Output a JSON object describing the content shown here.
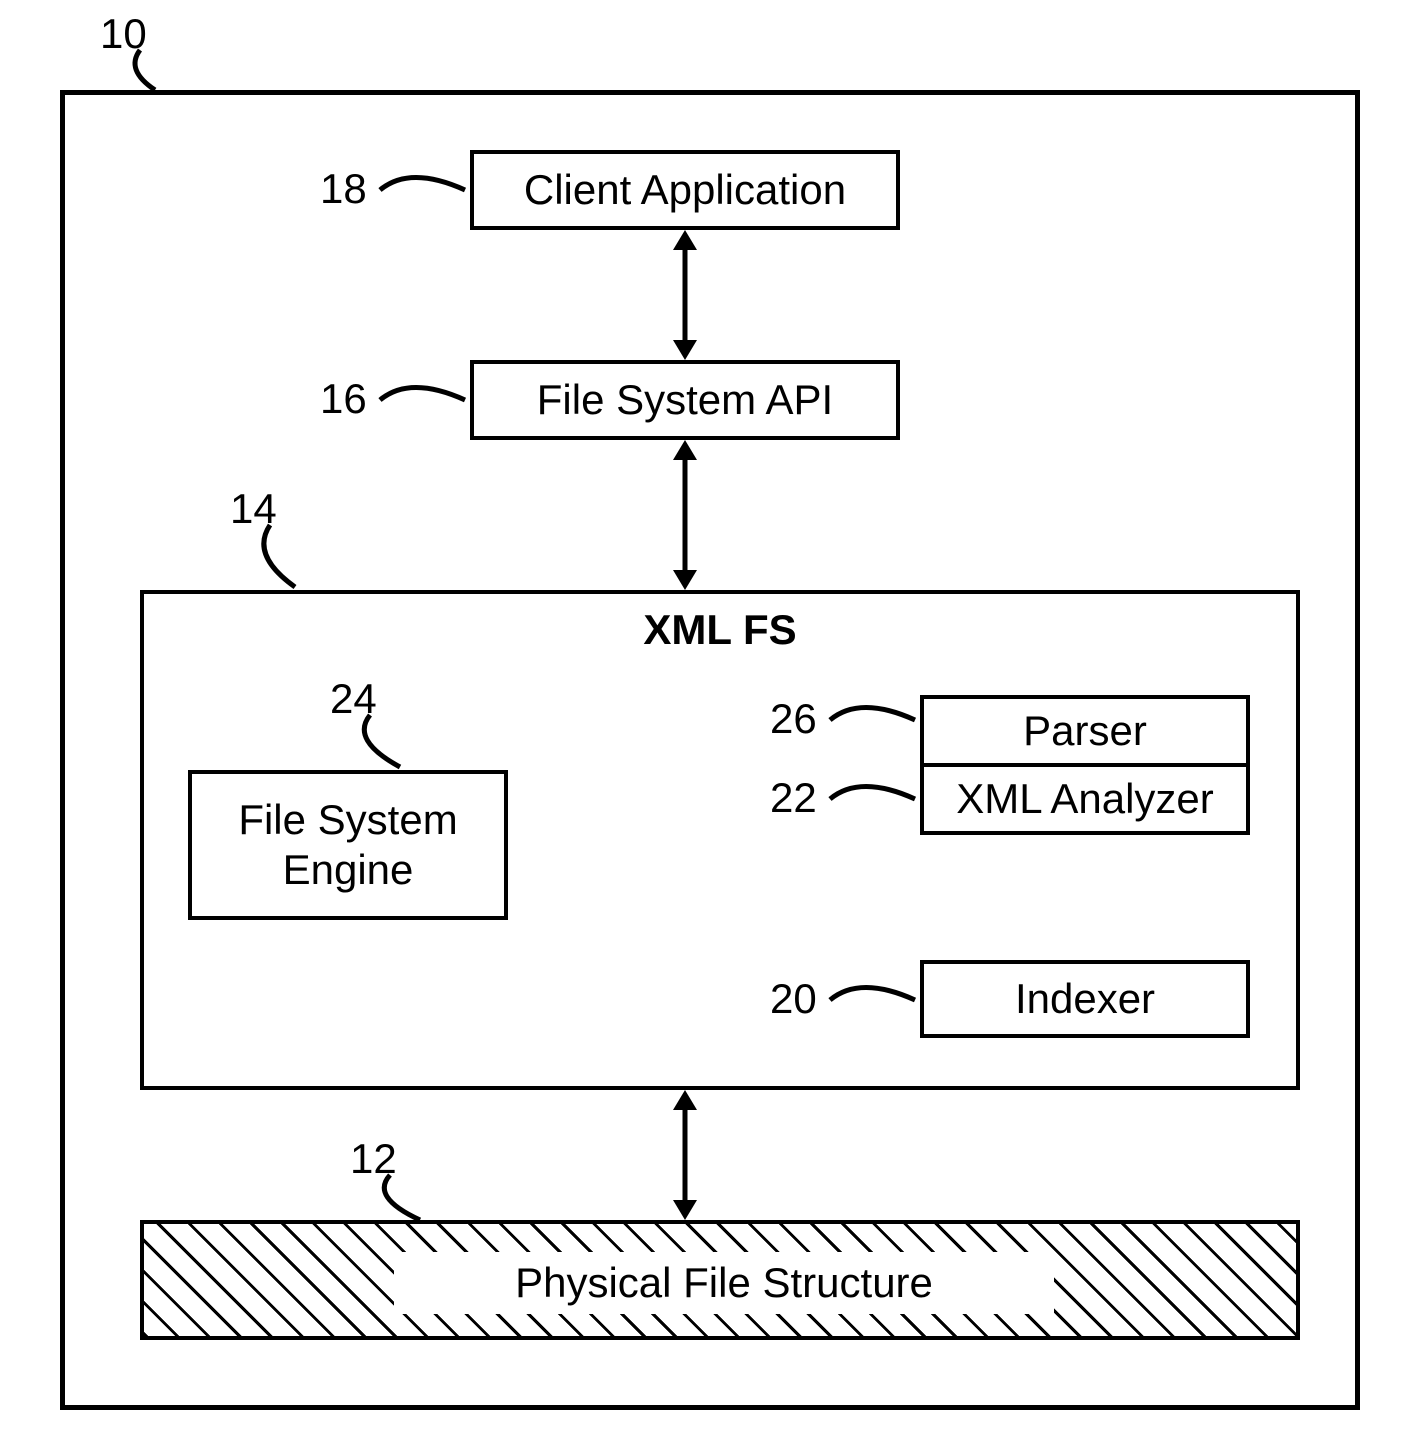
{
  "labels": {
    "ref10": "10",
    "ref18": "18",
    "ref16": "16",
    "ref14": "14",
    "ref24": "24",
    "ref26": "26",
    "ref22": "22",
    "ref20": "20",
    "ref12": "12"
  },
  "boxes": {
    "client_app": "Client Application",
    "fs_api": "File System API",
    "xml_fs_title": "XML FS",
    "fs_engine": "File System\nEngine",
    "parser": "Parser",
    "xml_analyzer": "XML Analyzer",
    "indexer": "Indexer",
    "physical": "Physical File Structure"
  }
}
